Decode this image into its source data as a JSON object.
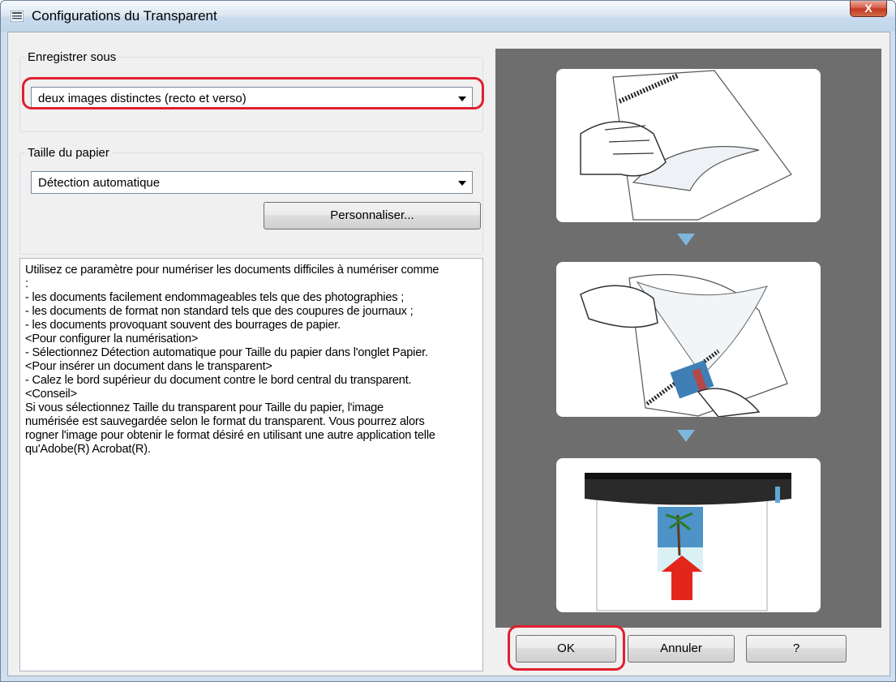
{
  "window": {
    "title": "Configurations du Transparent",
    "close_label": "X"
  },
  "save_as": {
    "group_label": "Enregistrer sous",
    "selected": "deux images distinctes (recto et verso)"
  },
  "paper_size": {
    "group_label": "Taille du papier",
    "selected": "Détection automatique",
    "customize_label": "Personnaliser..."
  },
  "info": {
    "lines": [
      "Utilisez ce paramètre pour numériser les documents difficiles à numériser comme",
      ":",
      "- les documents facilement endommageables tels que des photographies ;",
      "- les documents de format non standard tels que des coupures de journaux ;",
      "- les documents provoquant souvent des bourrages de papier.",
      "",
      "<Pour configurer la numérisation>",
      "- Sélectionnez Détection automatique pour Taille du papier dans l'onglet Papier.",
      "",
      "<Pour insérer un document dans le transparent>",
      "- Calez le bord supérieur du document contre le bord central du transparent.",
      "",
      "<Conseil>",
      "Si vous sélectionnez Taille du transparent pour Taille du papier, l'image",
      "numérisée est sauvegardée selon le format du transparent. Vous pourrez alors",
      "rogner l'image pour obtenir le format désiré en utilisant une autre application telle",
      "qu'Adobe(R) Acrobat(R)."
    ]
  },
  "buttons": {
    "ok": "OK",
    "cancel": "Annuler",
    "help": "?"
  },
  "colors": {
    "highlight_ring": "#e0202f",
    "illustration_bg": "#6e6e6e",
    "step_arrow": "#7fb6dc"
  }
}
